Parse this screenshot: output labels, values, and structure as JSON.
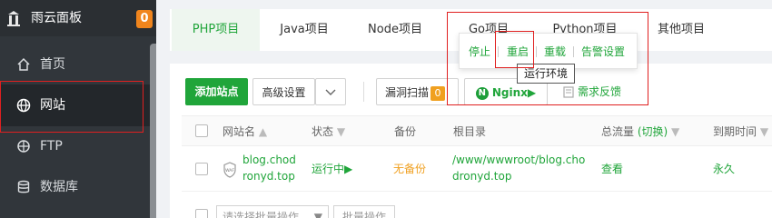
{
  "app": {
    "title": "雨云面板",
    "notice_count": "0"
  },
  "sidebar": {
    "items": [
      {
        "label": "首页",
        "icon": "home-icon"
      },
      {
        "label": "网站",
        "icon": "globe-icon",
        "active": true
      },
      {
        "label": "FTP",
        "icon": "ftp-icon"
      },
      {
        "label": "数据库",
        "icon": "database-icon"
      }
    ]
  },
  "tabs": [
    "PHP项目",
    "Java项目",
    "Node项目",
    "Go项目",
    "Python项目",
    "其他项目"
  ],
  "toolbar": {
    "add_site": "添加站点",
    "advanced": "高级设置",
    "vuln_scan": "漏洞扫描",
    "vuln_count": "0",
    "nginx": "Nginx",
    "feedback": "需求反馈"
  },
  "popup": {
    "stop": "停止",
    "restart": "重启",
    "reload": "重载",
    "alert_settings": "告警设置",
    "tooltip": "运行环境"
  },
  "table": {
    "headers": {
      "site_name": "网站名",
      "status": "状态",
      "backup": "备份",
      "root_dir": "根目录",
      "traffic": "总流量",
      "traffic_switch": "(切换)",
      "expire": "到期时间"
    },
    "rows": [
      {
        "site_line1": "blog.chod",
        "site_line2": "ronyd.top",
        "waf": "WAF",
        "status": "运行中",
        "backup": "无备份",
        "root_line1": "/www/wwwroot/blog.cho",
        "root_line2": "dronyd.top",
        "traffic": "查看",
        "expire": "永久"
      }
    ]
  },
  "batch": {
    "select_placeholder": "请选择批量操作",
    "button": "批量操作"
  },
  "colors": {
    "accent": "#20a53a",
    "warning": "#f0a020",
    "highlight": "#e02020"
  }
}
